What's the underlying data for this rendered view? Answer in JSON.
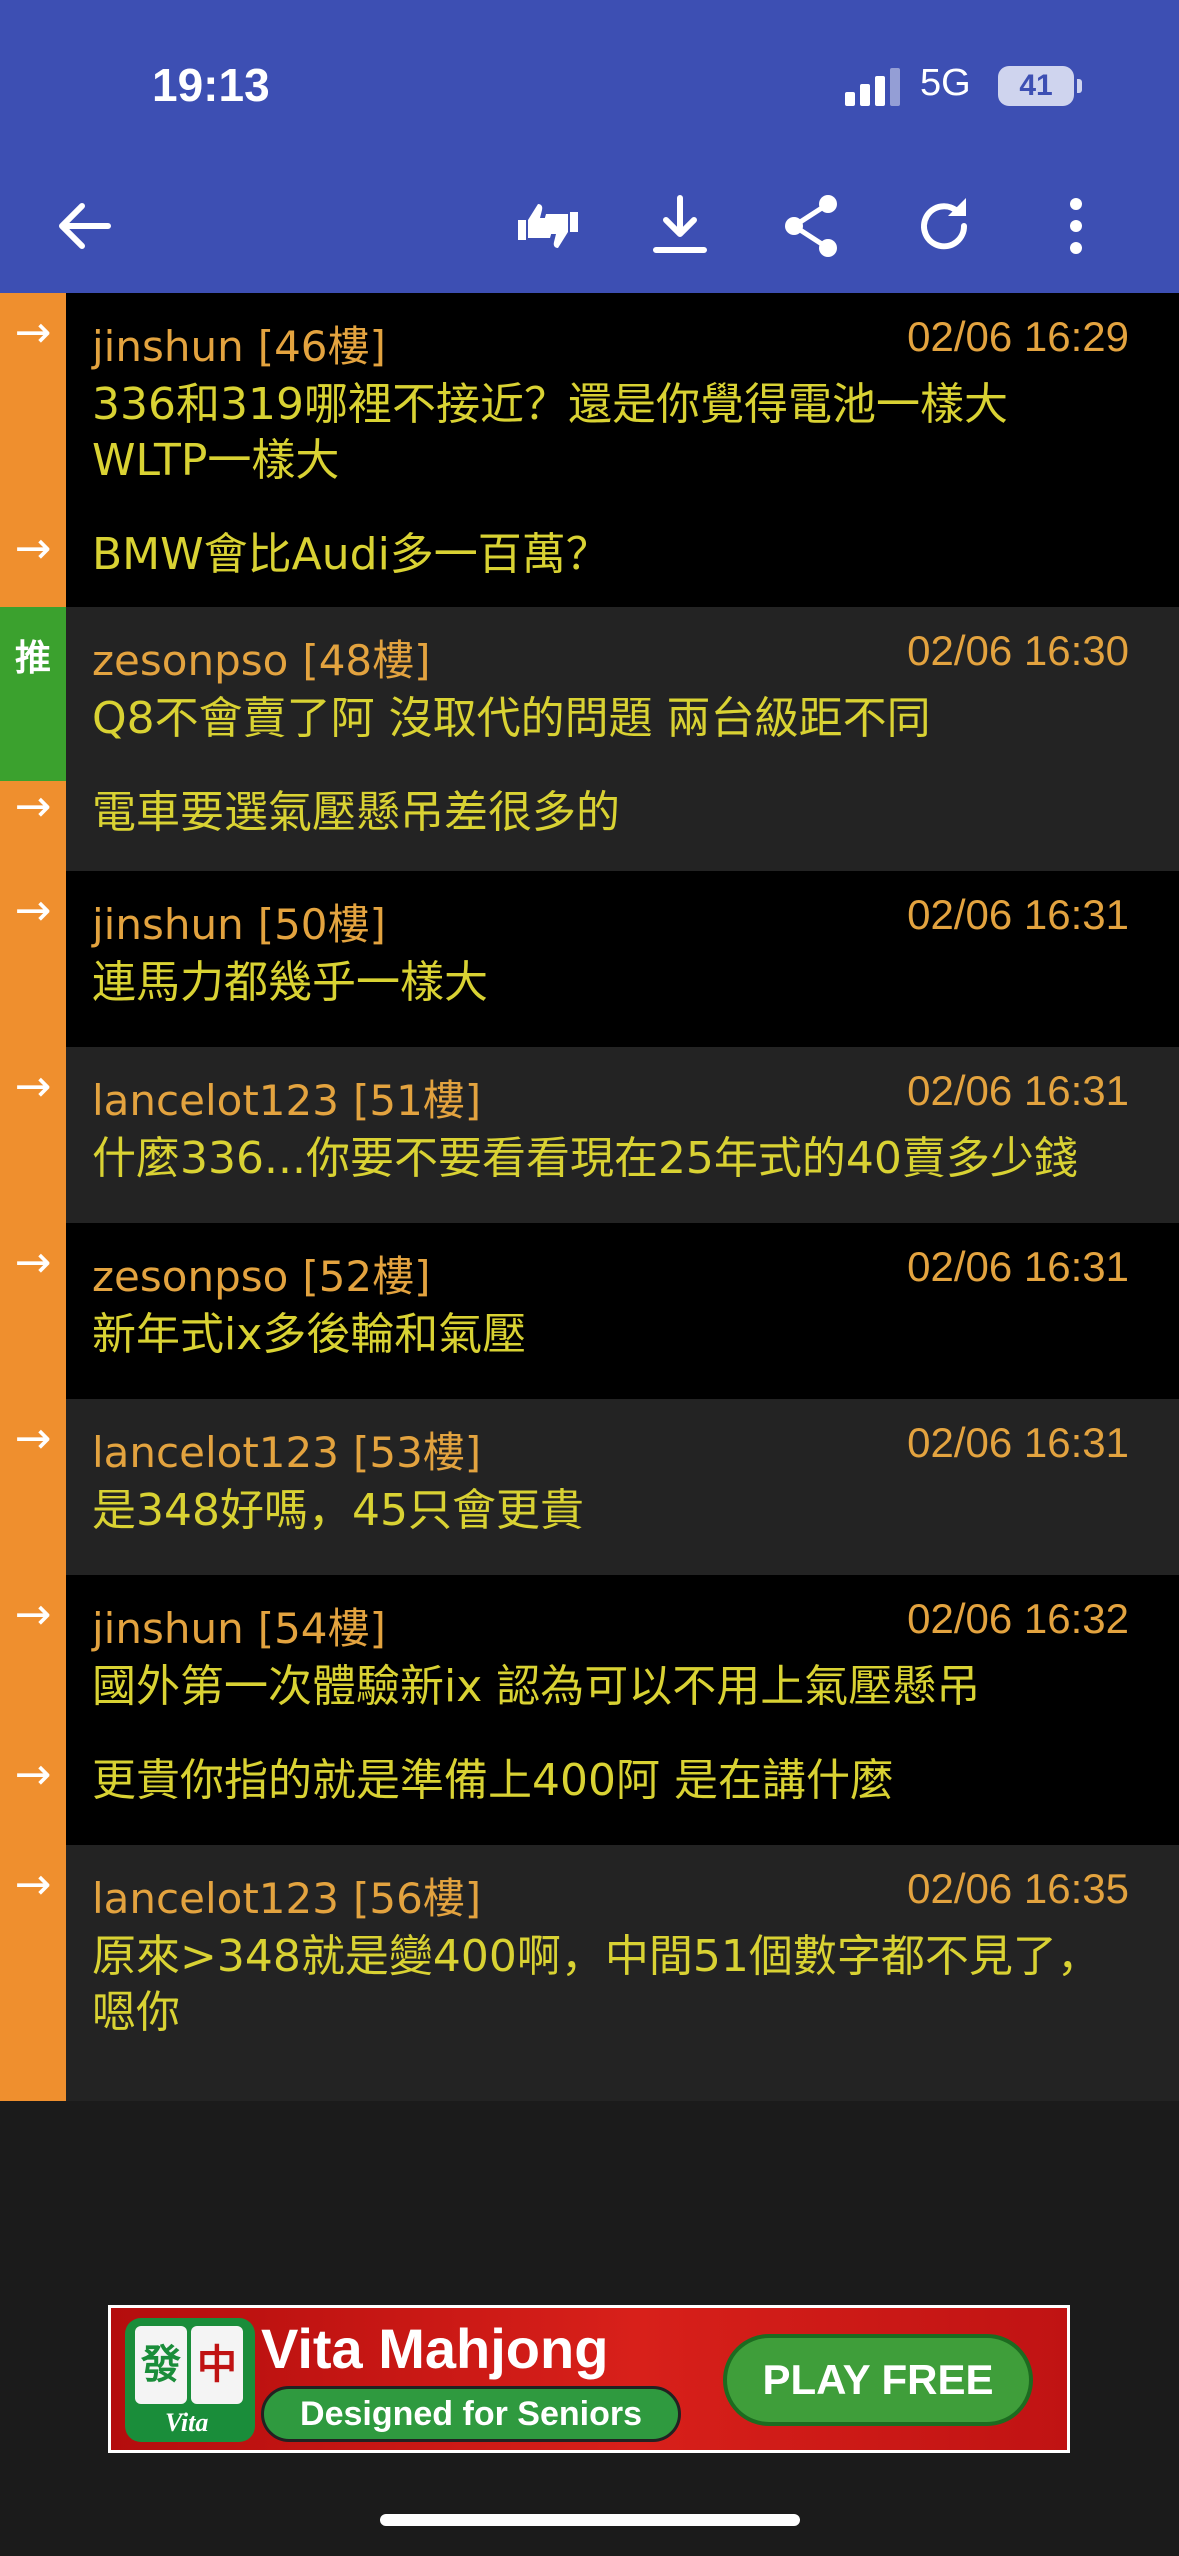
{
  "status": {
    "time": "19:13",
    "network": "5G",
    "battery": "41"
  },
  "toolbar": {
    "icons": [
      "back-arrow-icon",
      "thumbs-icon",
      "download-icon",
      "share-icon",
      "refresh-icon",
      "more-vertical-icon"
    ]
  },
  "posts": [
    {
      "user": "jinshun",
      "floor": "[46樓]",
      "time": "02/06 16:29",
      "mark": "→",
      "text": "336和319哪裡不接近？還是你覺得電池一樣大WLTP一樣大",
      "followup": {
        "mark": "→",
        "text": "BMW會比Audi多一百萬？"
      }
    },
    {
      "user": "zesonpso",
      "floor": "[48樓]",
      "time": "02/06 16:30",
      "mark": "推",
      "text": "Q8不會賣了阿 沒取代的問題 兩台級距不同",
      "followup": {
        "mark": "→",
        "text": "電車要選氣壓懸吊差很多的"
      }
    },
    {
      "user": "jinshun",
      "floor": "[50樓]",
      "time": "02/06 16:31",
      "mark": "→",
      "text": "連馬力都幾乎一樣大"
    },
    {
      "user": "lancelot123",
      "floor": "[51樓]",
      "time": "02/06 16:31",
      "mark": "→",
      "text": "什麼336...你要不要看看現在25年式的40賣多少錢"
    },
    {
      "user": "zesonpso",
      "floor": "[52樓]",
      "time": "02/06 16:31",
      "mark": "→",
      "text": "新年式ix多後輪和氣壓"
    },
    {
      "user": "lancelot123",
      "floor": "[53樓]",
      "time": "02/06 16:31",
      "mark": "→",
      "text": "是348好嗎，45只會更貴"
    },
    {
      "user": "jinshun",
      "floor": "[54樓]",
      "time": "02/06 16:32",
      "mark": "→",
      "text": "國外第一次體驗新ix 認為可以不用上氣壓懸吊",
      "followup": {
        "mark": "→",
        "text": "更貴你指的就是準備上400阿 是在講什麼"
      }
    },
    {
      "user": "lancelot123",
      "floor": "[56樓]",
      "time": "02/06 16:35",
      "mark": "→",
      "text": "原來>348就是變400啊，中間51個數字都不見了，嗯你"
    }
  ],
  "ad": {
    "title": "Vita Mahjong",
    "subtitle": "Designed for Seniors",
    "button": "PLAY FREE",
    "tile1": "發",
    "tile2": "中",
    "brand": "Vita"
  }
}
